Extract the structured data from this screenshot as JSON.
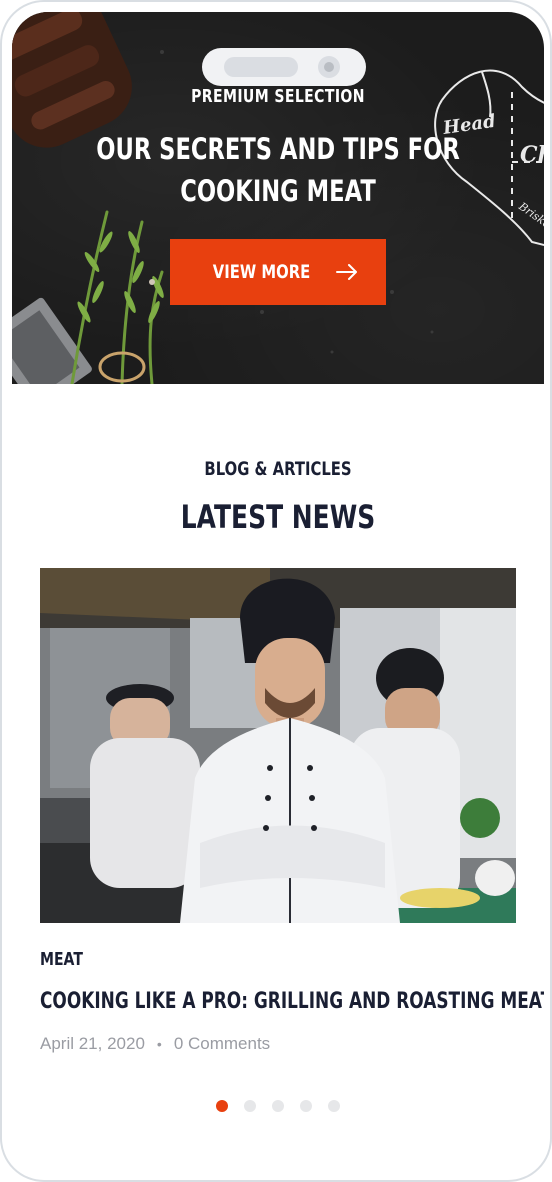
{
  "hero": {
    "kicker": "PREMIUM SELECTION",
    "title_line1": "OUR SECRETS AND TIPS FOR",
    "title_line2": "COOKING MEAT",
    "cta_label": "VIEW MORE",
    "chart_words": [
      "Head",
      "Ch",
      "Brisket"
    ]
  },
  "blog": {
    "kicker": "BLOG & ARTICLES",
    "title": "LATEST NEWS",
    "post": {
      "category": "MEAT",
      "title": "COOKING LIKE A PRO: GRILLING AND ROASTING MEAT TIPS",
      "date": "April 21, 2020",
      "separator": "•",
      "comments": "0 Comments"
    },
    "pager": {
      "total": 5,
      "active": 1
    }
  },
  "colors": {
    "accent": "#e8400f",
    "heading": "#1a1f33",
    "meta": "#9a9ca3",
    "hero_bg": "#1c1c1c"
  },
  "icons": [
    "arrow-right-icon"
  ]
}
